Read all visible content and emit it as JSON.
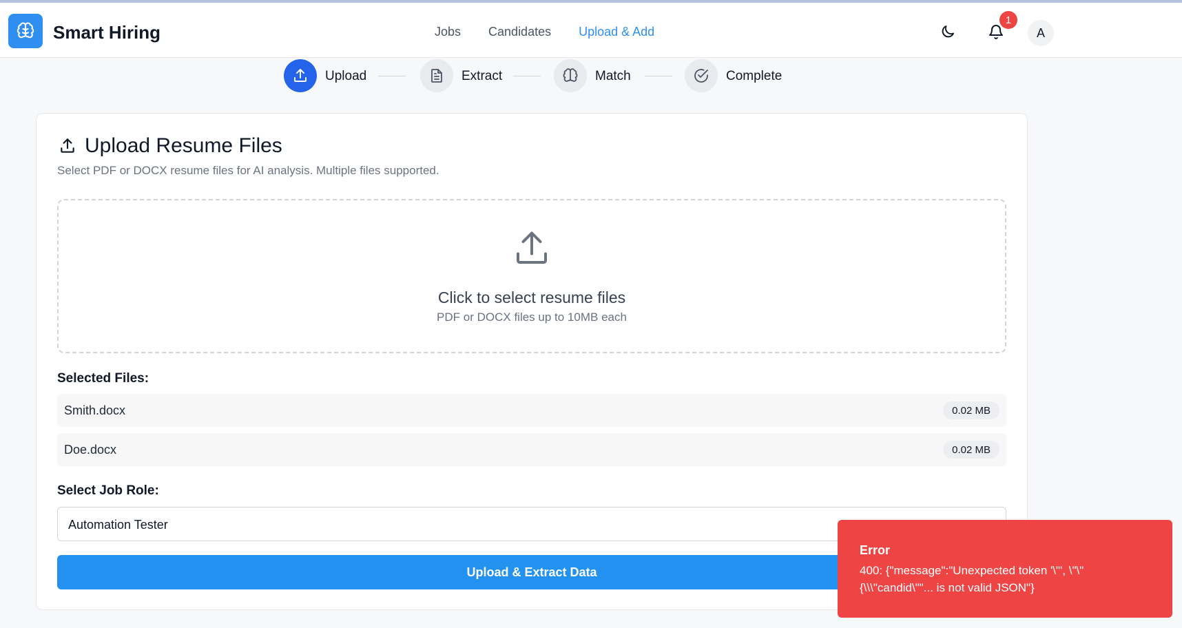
{
  "app": {
    "brand": "Smart Hiring",
    "brand_icon": "brain-icon"
  },
  "nav": {
    "items": [
      {
        "label": "Jobs",
        "active": false
      },
      {
        "label": "Candidates",
        "active": false
      },
      {
        "label": "Upload & Add",
        "active": true
      }
    ]
  },
  "header": {
    "theme_icon": "moon-icon",
    "notification_icon": "bell-icon",
    "notification_count": "1",
    "avatar_initial": "A"
  },
  "stepper": {
    "steps": [
      {
        "label": "Upload",
        "icon": "upload-icon",
        "active": true
      },
      {
        "label": "Extract",
        "icon": "document-icon",
        "active": false
      },
      {
        "label": "Match",
        "icon": "brain-icon",
        "active": false
      },
      {
        "label": "Complete",
        "icon": "check-circle-icon",
        "active": false
      }
    ]
  },
  "card": {
    "title": "Upload Resume Files",
    "subtitle": "Select PDF or DOCX resume files for AI analysis. Multiple files supported.",
    "dropzone": {
      "title": "Click to select resume files",
      "subtitle": "PDF or DOCX files up to 10MB each"
    },
    "selected_files_label": "Selected Files:",
    "files": [
      {
        "name": "Smith.docx",
        "size": "0.02 MB"
      },
      {
        "name": "Doe.docx",
        "size": "0.02 MB"
      }
    ],
    "job_role_label": "Select Job Role:",
    "job_role_value": "Automation Tester",
    "submit_label": "Upload & Extract Data"
  },
  "toast": {
    "title": "Error",
    "message": "400: {\"message\":\"Unexpected token '\\\"', \\\"\\\"{\\\\\\\"candid\\\"\"... is not valid JSON\"}"
  },
  "colors": {
    "accent": "#2f8ff0",
    "active_step": "#2563eb",
    "error": "#ef4444"
  }
}
